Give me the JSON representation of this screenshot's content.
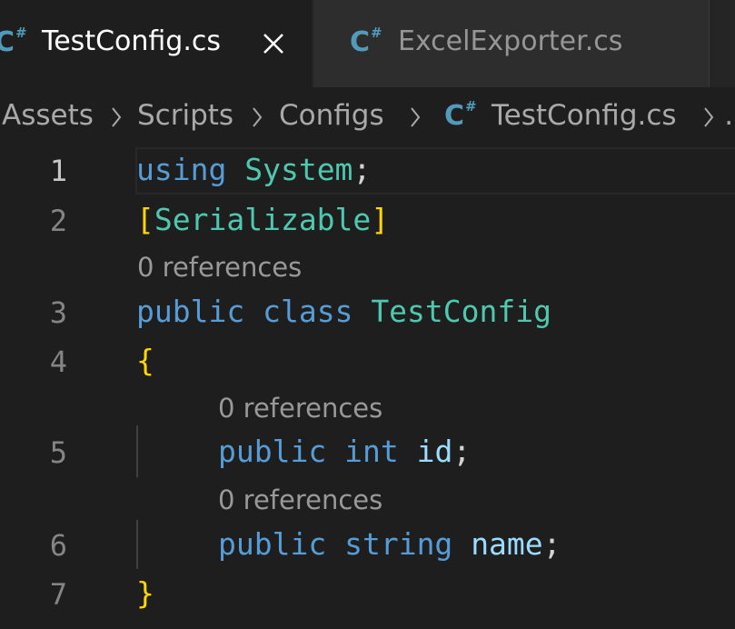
{
  "tabs": [
    {
      "label": "TestConfig.cs",
      "icon": "csharp-file-icon",
      "active": true
    },
    {
      "label": "ExcelExporter.cs",
      "icon": "csharp-file-icon",
      "active": false
    }
  ],
  "file_icon_text": {
    "main": "C",
    "sup": "#"
  },
  "breadcrumb": {
    "items": [
      "Assets",
      "Scripts",
      "Configs",
      "TestConfig.cs"
    ],
    "overflow": "…"
  },
  "codelens": {
    "class_refs": "0 references",
    "id_refs": "0 references",
    "name_refs": "0 references"
  },
  "lines": [
    {
      "number": "1",
      "tokens": {
        "kw": "using",
        "space": " ",
        "type": "System",
        "punc": ";"
      }
    },
    {
      "number": "2",
      "tokens": {
        "open": "[",
        "type": "Serializable",
        "close": "]"
      }
    },
    {
      "number": "3",
      "tokens": {
        "kw1": "public",
        "kw2": "class",
        "type": "TestConfig"
      }
    },
    {
      "number": "4",
      "tokens": {
        "brace": "{"
      }
    },
    {
      "number": "5",
      "tokens": {
        "kw1": "public",
        "kw2": "int",
        "var": "id",
        "punc": ";"
      }
    },
    {
      "number": "6",
      "tokens": {
        "kw1": "public",
        "kw2": "string",
        "var": "name",
        "punc": ";"
      }
    },
    {
      "number": "7",
      "tokens": {
        "brace": "}"
      }
    }
  ],
  "colors": {
    "editor_bg": "#1e1e1e",
    "keyword": "#569cd6",
    "type": "#4ec9b0",
    "variable": "#9cdcfe",
    "bracket": "#ffd700",
    "csharp_icon": "#519aba"
  }
}
